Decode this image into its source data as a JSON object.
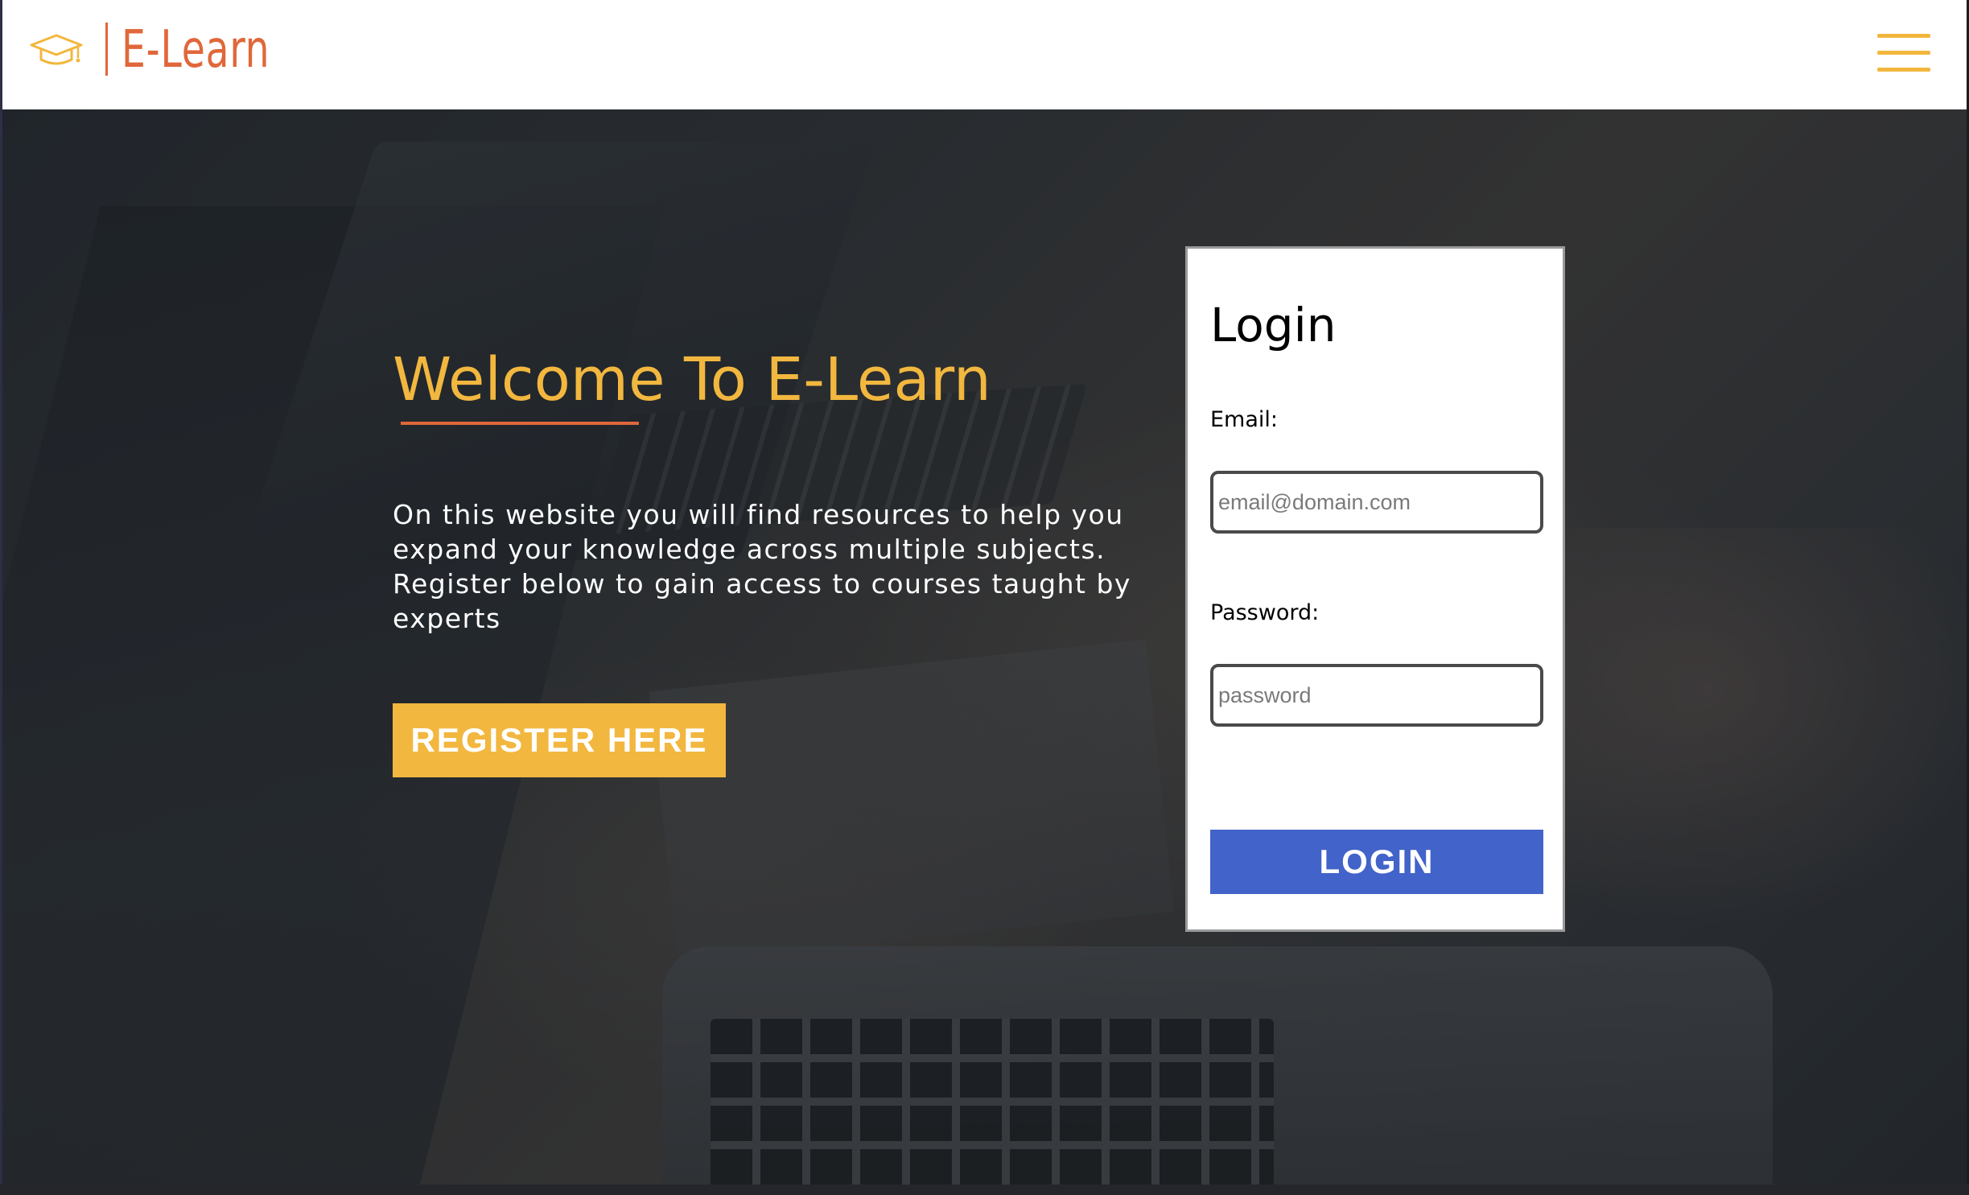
{
  "header": {
    "logo_icon": "graduation-cap-icon",
    "brand_name": "E-Learn",
    "menu_icon": "hamburger-menu-icon"
  },
  "hero": {
    "title": "Welcome To E-Learn",
    "description": "On this website you will find resources to help you expand your knowledge across multiple subjects. Register below to gain access to courses taught by experts",
    "register_label": "REGISTER HERE"
  },
  "login": {
    "title": "Login",
    "email_label": "Email:",
    "email_placeholder": "email@domain.com",
    "email_value": "",
    "password_label": "Password:",
    "password_placeholder": "password",
    "password_value": "",
    "submit_label": "LOGIN"
  },
  "colors": {
    "brand_orange": "#e0673a",
    "accent_yellow": "#f2b73f",
    "login_blue": "#4263c9"
  }
}
